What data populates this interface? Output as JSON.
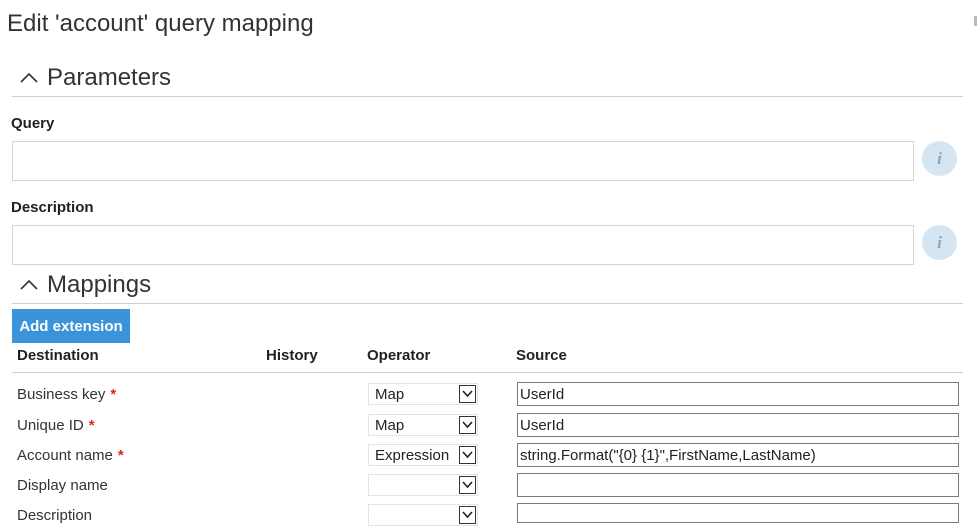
{
  "title": "Edit 'account' query mapping",
  "parameters": {
    "header": "Parameters",
    "query_label": "Query",
    "query_value": "",
    "description_label": "Description",
    "description_value": "",
    "info_icon": "info-icon",
    "info_glyph": "i"
  },
  "mappings": {
    "header": "Mappings",
    "add_extension_label": "Add extension",
    "columns": {
      "destination": "Destination",
      "history": "History",
      "operator": "Operator",
      "source": "Source"
    },
    "rows": [
      {
        "destination": "Business key",
        "required": "*",
        "operator": "Map",
        "source": "UserId"
      },
      {
        "destination": "Unique ID",
        "required": "*",
        "operator": "Map",
        "source": "UserId"
      },
      {
        "destination": "Account name",
        "required": "*",
        "operator": "Expression",
        "source": "string.Format(\"{0} {1}\",FirstName,LastName)"
      },
      {
        "destination": "Display name",
        "required": "",
        "operator": "",
        "source": ""
      },
      {
        "destination": "Description",
        "required": "",
        "operator": "",
        "source": ""
      }
    ]
  },
  "colors": {
    "accent": "#3b93d9",
    "required": "#dd2222",
    "info_bg": "#d6e5f2"
  }
}
